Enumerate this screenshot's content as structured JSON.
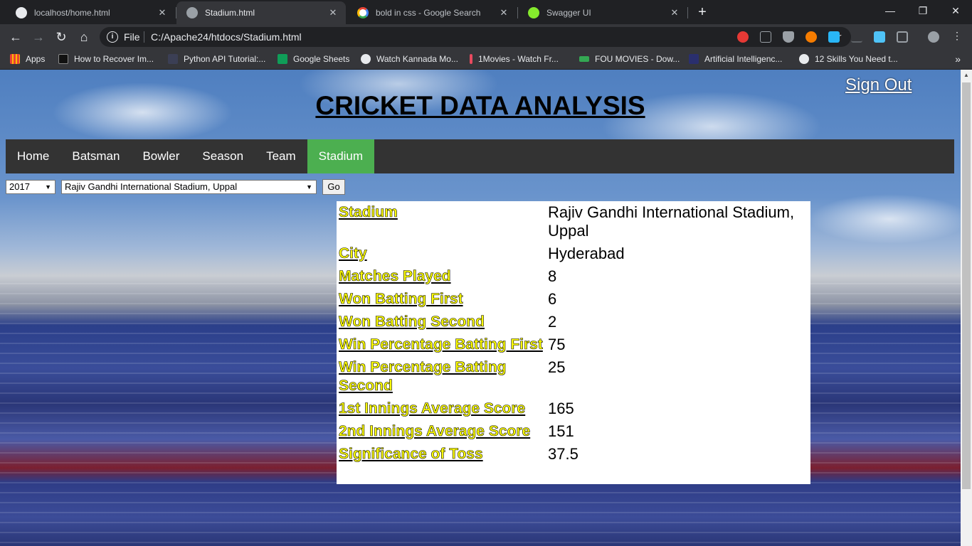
{
  "browser": {
    "tabs": [
      {
        "title": "localhost/home.html",
        "active": false
      },
      {
        "title": "Stadium.html",
        "active": true
      },
      {
        "title": "bold in css - Google Search",
        "active": false
      },
      {
        "title": "Swagger UI",
        "active": false
      }
    ],
    "new_tab": "+",
    "window_controls": {
      "minimize": "—",
      "restore": "❐",
      "close": "✕"
    },
    "nav": {
      "back": "←",
      "forward": "→",
      "reload": "↻",
      "home": "⌂"
    },
    "address": {
      "scheme": "File",
      "url": "C:/Apache24/htdocs/Stadium.html",
      "star": "☆"
    },
    "bookmarks": [
      {
        "label": "Apps",
        "icon": "apps-grid-icon",
        "color": "#f4b400"
      },
      {
        "label": "How to Recover Im...",
        "icon": "htg-icon",
        "color": "#111111"
      },
      {
        "label": "Python API Tutorial:...",
        "icon": "python-icon",
        "color": "#3b3f55"
      },
      {
        "label": "Google Sheets",
        "icon": "sheets-icon",
        "color": "#0f9d58"
      },
      {
        "label": "Watch Kannada Mo...",
        "icon": "globe-icon",
        "color": "#e8eaed"
      },
      {
        "label": "1Movies - Watch Fr...",
        "icon": "1movies-icon",
        "color": "#e84a5f"
      },
      {
        "label": "FOU MOVIES - Dow...",
        "icon": "fm-icon",
        "color": "#34a853"
      },
      {
        "label": "Artificial Intelligenc...",
        "icon": "ai-icon",
        "color": "#2a2f6e"
      },
      {
        "label": "12 Skills You Need t...",
        "icon": "globe-icon",
        "color": "#e8eaed"
      }
    ],
    "bookmarks_more": "»"
  },
  "page": {
    "sign_out": "Sign Out",
    "title": "CRICKET DATA ANALYSIS",
    "nav": [
      "Home",
      "Batsman",
      "Bowler",
      "Season",
      "Team",
      "Stadium"
    ],
    "active_nav": "Stadium",
    "accent_color": "#4caf50",
    "filters": {
      "year": "2017",
      "stadium": "Rajiv Gandhi International Stadium, Uppal",
      "go": "Go"
    },
    "stats": [
      {
        "label": "Stadium",
        "value": "Rajiv Gandhi International Stadium, Uppal"
      },
      {
        "label": "City",
        "value": "Hyderabad"
      },
      {
        "label": "Matches Played",
        "value": "8"
      },
      {
        "label": "Won Batting First",
        "value": "6"
      },
      {
        "label": "Won Batting Second",
        "value": "2"
      },
      {
        "label": "Win Percentage Batting First",
        "value": "75"
      },
      {
        "label": "Win Percentage Batting Second",
        "value": "25"
      },
      {
        "label": "1st Innings Average Score",
        "value": "165"
      },
      {
        "label": "2nd Innings Average Score",
        "value": "151"
      },
      {
        "label": "Significance of Toss",
        "value": "37.5"
      }
    ]
  }
}
